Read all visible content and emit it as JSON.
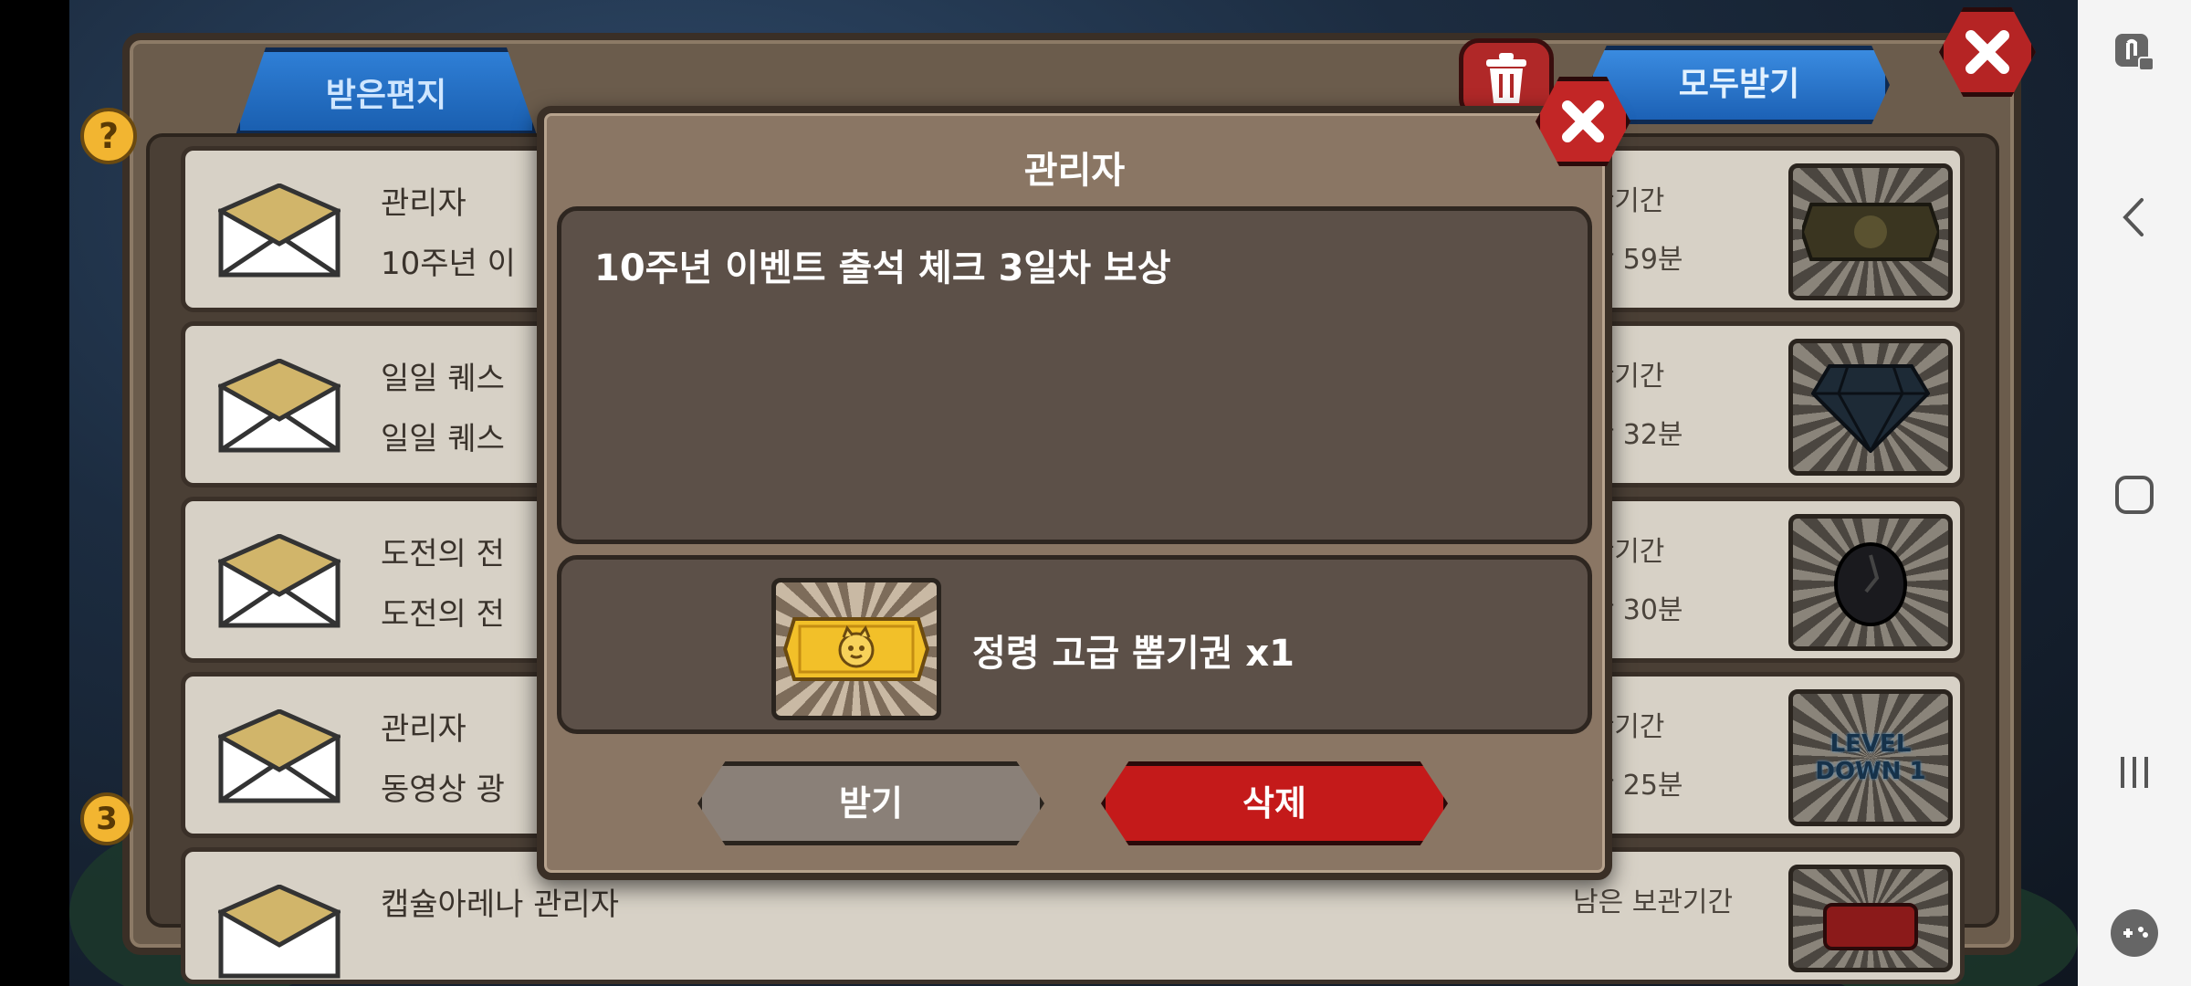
{
  "mailbox": {
    "tab_label": "받은편지",
    "collect_all_label": "모두받기",
    "help_badge": "?",
    "count_badge": "3",
    "rows": [
      {
        "sender": "관리자",
        "subject": "10주년 이",
        "expire_label": "보관기간",
        "expire_time": "시간 59분",
        "item_icon": "ticket-icon"
      },
      {
        "sender": "일일 퀘스",
        "subject": "일일 퀘스",
        "expire_label": "보관기간",
        "expire_time": "시간 32분",
        "item_icon": "diamond-icon"
      },
      {
        "sender": "도전의 전",
        "subject": "도전의 전",
        "expire_label": "보관기간",
        "expire_time": "시간 30분",
        "item_icon": "egg-icon"
      },
      {
        "sender": "관리자",
        "subject": "동영상 광",
        "expire_label": "보관기간",
        "expire_time": "시간 25분",
        "item_icon": "level-down-icon",
        "item_text": "LEVEL DOWN 1"
      },
      {
        "sender": "캡슐아레나 관리자",
        "subject": "",
        "expire_label": "남은 보관기간",
        "expire_time": "",
        "item_icon": "chest-icon"
      }
    ]
  },
  "dialog": {
    "title": "관리자",
    "message": "10주년 이벤트 출석 체크 3일차 보상",
    "reward_text": "정령 고급 뽑기권 x1",
    "receive_label": "받기",
    "delete_label": "삭제"
  },
  "colors": {
    "accent_blue": "#2f7fd6",
    "danger_red": "#c41a1a",
    "ticket_gold": "#f2c029"
  }
}
